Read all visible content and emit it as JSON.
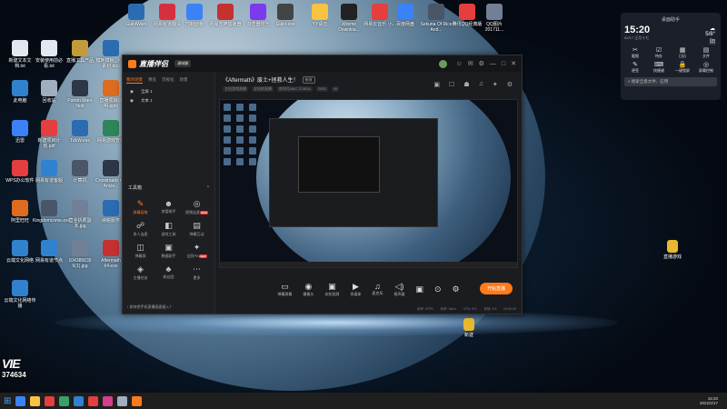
{
  "desktop_icons": [
    {
      "label": "GuildWars",
      "color": "#2b6cb0"
    },
    {
      "label": "网易有道翻译",
      "color": "#d6303f"
    },
    {
      "label": "控制面板",
      "color": "#3b82f6"
    },
    {
      "label": "网易雷神加速器",
      "color": "#c53030"
    },
    {
      "label": "浏览器时光",
      "color": "#7c3aed"
    },
    {
      "label": "Guild.exe",
      "color": "#444"
    },
    {
      "label": "YY语音",
      "color": "#f6c343"
    },
    {
      "label": "Xtreme Downloa...",
      "color": "#222"
    },
    {
      "label": "网易云音乐·小...",
      "color": "#e53e3e"
    },
    {
      "label": "百度网盘",
      "color": "#3b82f6"
    },
    {
      "label": "Sekuna Of Rice And...",
      "color": "#4a5568"
    },
    {
      "label": "腾讯QQ经典版",
      "color": "#e53e3e"
    },
    {
      "label": "QQ图片201711...",
      "color": "#718096"
    },
    {
      "label": "新建文本文档.txt",
      "color": "#e2e8f0"
    },
    {
      "label": "安装使用前必看.txt",
      "color": "#e2e8f0"
    },
    {
      "label": "直播工具产品",
      "color": "#c49a3a"
    },
    {
      "label": "模板模板_人物素材.doc",
      "color": "#2b6cb0"
    },
    {
      "label": "此电脑",
      "color": "#3182ce"
    },
    {
      "label": "回收站",
      "color": "#a0aec0"
    },
    {
      "label": "Patron Mare Nob",
      "color": "#2d3748"
    },
    {
      "label": "直播项目说明.pptx",
      "color": "#dd6b20"
    },
    {
      "label": "迅雷",
      "color": "#3b82f6"
    },
    {
      "label": "新建项目计划.pdf",
      "color": "#e53e3e"
    },
    {
      "label": "TdxW.exe",
      "color": "#2b6cb0"
    },
    {
      "label": "网易游戏管理",
      "color": "#2f855a"
    },
    {
      "label": "WPS办公软件",
      "color": "#e53e3e"
    },
    {
      "label": "网易有道客服",
      "color": "#3182ce"
    },
    {
      "label": "计算机",
      "color": "#4a5568"
    },
    {
      "label": "Crossroads Inn Ancie...",
      "color": "#2d3748"
    },
    {
      "label": "阿里旺旺",
      "color": "#dd6b20"
    },
    {
      "label": "Kingdomcome.exe",
      "color": "#4a5568"
    },
    {
      "label": "营业执照副本.jpg",
      "color": "#718096"
    },
    {
      "label": "纳税服务",
      "color": "#2b6cb0"
    },
    {
      "label": "云端文化网络",
      "color": "#3182ce"
    },
    {
      "label": "网易有道节点",
      "color": "#3182ce"
    },
    {
      "label": "104385635 6(1).jpg",
      "color": "#718096"
    },
    {
      "label": "Aftermath 64.exe",
      "color": "#c53030"
    },
    {
      "label": "云端文化网络传播",
      "color": "#3182ce"
    }
  ],
  "right_folders": [
    {
      "label": "直播游戏",
      "color": "#e8b830"
    },
    {
      "label": "新建",
      "color": "#e8b830"
    },
    {
      "label": "素材",
      "color": "#e8b830"
    }
  ],
  "widget": {
    "title": "桌面助手",
    "time": "15:20",
    "date": "02/17 正月十七",
    "weather": "5/8°",
    "weather_desc": "阴",
    "items": [
      {
        "label": "截图",
        "glyph": "✂"
      },
      {
        "label": "待办",
        "glyph": "☑"
      },
      {
        "label": "日历",
        "glyph": "▦"
      },
      {
        "label": "文件",
        "glyph": "▤"
      },
      {
        "label": "便签",
        "glyph": "✎"
      },
      {
        "label": "快捷键",
        "glyph": "⌨"
      },
      {
        "label": "一键锁屏",
        "glyph": "🔒"
      },
      {
        "label": "屏幕控制",
        "glyph": "◎"
      }
    ],
    "search_placeholder": "搜索全盘文件、应用"
  },
  "app": {
    "name": "直播伴侣",
    "version": "测试版",
    "window_controls": [
      "☺",
      "✉",
      "⚙",
      "—",
      "□",
      "✕"
    ],
    "left_tabs": [
      "我的场景",
      "预览",
      "可视化",
      "场景"
    ],
    "scenes": [
      "全屏 1",
      "文本 1"
    ],
    "tools_title": "工具箱",
    "tools": [
      {
        "label": "屏幕画笔",
        "glyph": "✎",
        "active": true,
        "badge": ""
      },
      {
        "label": "房管助手",
        "glyph": "☻",
        "active": false,
        "badge": ""
      },
      {
        "label": "视频连麦",
        "glyph": "◎",
        "active": false,
        "badge": "NEW"
      },
      {
        "label": "多人连麦",
        "glyph": "☍",
        "active": false,
        "badge": ""
      },
      {
        "label": "游戏工具",
        "glyph": "◧",
        "active": false,
        "badge": ""
      },
      {
        "label": "弹幕互动",
        "glyph": "▤",
        "active": false,
        "badge": ""
      },
      {
        "label": "弹幕屏",
        "glyph": "◫",
        "active": false,
        "badge": ""
      },
      {
        "label": "数据助手",
        "glyph": "▣",
        "active": false,
        "badge": ""
      },
      {
        "label": "全民PK",
        "glyph": "✦",
        "active": false,
        "badge": "NEW"
      },
      {
        "label": "主播任务",
        "glyph": "◈",
        "active": false,
        "badge": ""
      },
      {
        "label": "粉丝团",
        "glyph": "♣",
        "active": false,
        "badge": ""
      },
      {
        "label": "更多",
        "glyph": "⋯",
        "active": false,
        "badge": ""
      }
    ],
    "left_bottom": "如何把手机直播画面接入？",
    "room_title": "《Aftermath》废土+拯救人生！",
    "room_tag": "修改",
    "room_meta": [
      "主机游戏直播",
      "全机房直播",
      "房间号ABC 374634",
      "2030",
      "40"
    ],
    "room_icons": [
      "▣",
      "☐",
      "☗",
      "♫",
      "✦",
      "⚙"
    ],
    "controls": [
      {
        "label": "弹幕屏幕",
        "glyph": "▭"
      },
      {
        "label": "摄像头",
        "glyph": "◉"
      },
      {
        "label": "本机投屏",
        "glyph": "▣"
      },
      {
        "label": "多媒体",
        "glyph": "▶"
      },
      {
        "label": "麦克风",
        "glyph": "♫"
      },
      {
        "label": "扬声器",
        "glyph": "◁)"
      }
    ],
    "side_ctrls": [
      "▣",
      "⊙",
      "⚙"
    ],
    "go_live": "开始直播",
    "status": [
      "帧率: 0FPS",
      "码率: 0kb/s",
      "CPU: 5%",
      "丢帧: 0%",
      "00:00:00"
    ]
  },
  "taskbar": {
    "start_glyph": "⊞",
    "icons": [
      "#3b82f6",
      "#f6c343",
      "#e53e3e",
      "#38a169",
      "#3182ce",
      "#e53e3e",
      "#d53f8c",
      "#a0aec0",
      "#ff7a1a"
    ],
    "time": "15:20",
    "date": "2022/2/17"
  },
  "watermark": {
    "logo": "VIE",
    "number": "374634"
  }
}
